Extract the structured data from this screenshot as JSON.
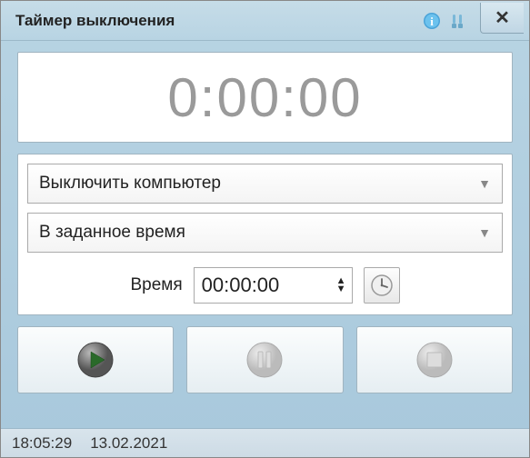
{
  "title": "Таймер выключения",
  "timer_display": "0:00:00",
  "action_dropdown": "Выключить компьютер",
  "mode_dropdown": "В заданное время",
  "time_label": "Время",
  "time_value": "00:00:00",
  "status": {
    "time": "18:05:29",
    "date": "13.02.2021"
  },
  "glyphs": {
    "close": "✕",
    "dd": "▼",
    "up": "▲",
    "down": "▼"
  }
}
